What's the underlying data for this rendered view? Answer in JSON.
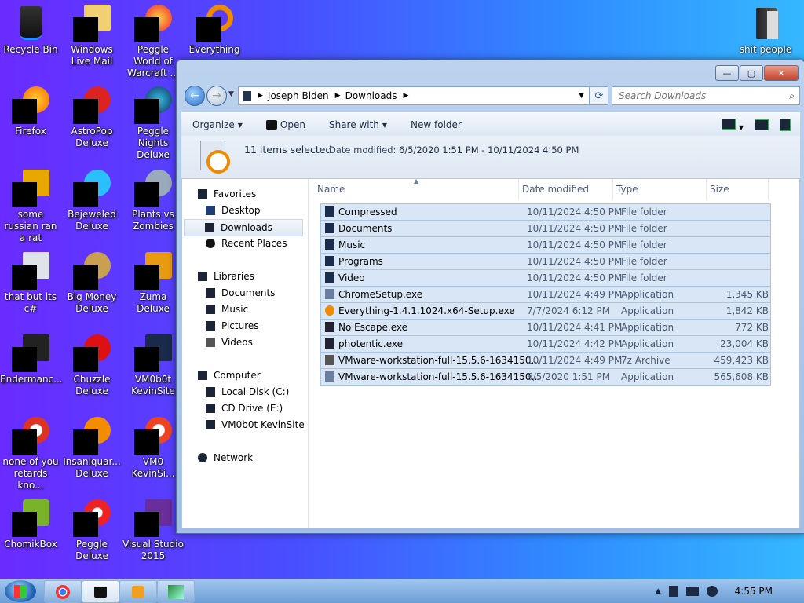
{
  "desktop": {
    "icons": [
      {
        "label": "Recycle Bin",
        "icon": "recycle-bin-icon"
      },
      {
        "label": "Windows Live Mail",
        "icon": "mail-icon"
      },
      {
        "label": "Peggle World of Warcraft ...",
        "icon": "game-icon"
      },
      {
        "label": "Everything",
        "icon": "search-app-icon"
      },
      {
        "label": "Firefox",
        "icon": "firefox-icon"
      },
      {
        "label": "AstroPop Deluxe",
        "icon": "game-icon"
      },
      {
        "label": "Peggle Nights Deluxe",
        "icon": "game-icon"
      },
      {
        "label": "some russian ran a rat",
        "icon": "file-icon"
      },
      {
        "label": "Bejeweled Deluxe",
        "icon": "game-icon"
      },
      {
        "label": "Plants vs Zombies",
        "icon": "game-icon"
      },
      {
        "label": "that but its c#",
        "icon": "file-icon"
      },
      {
        "label": "Big Money Deluxe",
        "icon": "game-icon"
      },
      {
        "label": "Zuma Deluxe",
        "icon": "game-icon"
      },
      {
        "label": "Endermanc...",
        "icon": "file-icon"
      },
      {
        "label": "Chuzzle Deluxe",
        "icon": "game-icon"
      },
      {
        "label": "VM0b0t KevinSite",
        "icon": "app-icon"
      },
      {
        "label": "none of you retards kno...",
        "icon": "chrome-icon"
      },
      {
        "label": "Insaniquar... Deluxe",
        "icon": "game-icon"
      },
      {
        "label": "VM0 KevinSi...",
        "icon": "chrome-icon"
      },
      {
        "label": "ChomikBox",
        "icon": "app-icon"
      },
      {
        "label": "Peggle Deluxe",
        "icon": "game-icon"
      },
      {
        "label": "Visual Studio 2015",
        "icon": "visual-studio-icon"
      },
      {
        "label": "shit people",
        "icon": "folder-icon"
      }
    ]
  },
  "window": {
    "caption": {
      "minimize": "—",
      "maximize": "▢",
      "close": "✕"
    },
    "address": {
      "segments": [
        "Joseph Biden",
        "Downloads"
      ]
    },
    "search": {
      "placeholder": "Search Downloads"
    },
    "toolbar": {
      "organize": "Organize",
      "open": "Open",
      "share_with": "Share with",
      "new_folder": "New folder"
    },
    "details": {
      "selected": "11 items selected",
      "date_label": "Date modified:",
      "date_range": "6/5/2020 1:51 PM - 10/11/2024 4:50 PM"
    },
    "nav": {
      "favorites": "Favorites",
      "desktop": "Desktop",
      "downloads": "Downloads",
      "recent": "Recent Places",
      "libraries": "Libraries",
      "documents": "Documents",
      "music": "Music",
      "pictures": "Pictures",
      "videos": "Videos",
      "computer": "Computer",
      "local_disk": "Local Disk (C:)",
      "cd_drive": "CD Drive (E:)",
      "vm_drive": "VM0b0t KevinSite",
      "network": "Network"
    },
    "columns": {
      "name": "Name",
      "date": "Date modified",
      "type": "Type",
      "size": "Size"
    },
    "files": [
      {
        "name": "Compressed",
        "date": "10/11/2024 4:50 PM",
        "type": "File folder",
        "size": "",
        "icon": "folder-icon"
      },
      {
        "name": "Documents",
        "date": "10/11/2024 4:50 PM",
        "type": "File folder",
        "size": "",
        "icon": "folder-icon"
      },
      {
        "name": "Music",
        "date": "10/11/2024 4:50 PM",
        "type": "File folder",
        "size": "",
        "icon": "folder-icon"
      },
      {
        "name": "Programs",
        "date": "10/11/2024 4:50 PM",
        "type": "File folder",
        "size": "",
        "icon": "folder-icon"
      },
      {
        "name": "Video",
        "date": "10/11/2024 4:50 PM",
        "type": "File folder",
        "size": "",
        "icon": "folder-icon"
      },
      {
        "name": "ChromeSetup.exe",
        "date": "10/11/2024 4:49 PM",
        "type": "Application",
        "size": "1,345 KB",
        "icon": "installer-icon"
      },
      {
        "name": "Everything-1.4.1.1024.x64-Setup.exe",
        "date": "7/7/2024 6:12 PM",
        "type": "Application",
        "size": "1,842 KB",
        "icon": "search-app-icon"
      },
      {
        "name": "No Escape.exe",
        "date": "10/11/2024 4:41 PM",
        "type": "Application",
        "size": "772 KB",
        "icon": "app-icon"
      },
      {
        "name": "photentic.exe",
        "date": "10/11/2024 4:42 PM",
        "type": "Application",
        "size": "23,004 KB",
        "icon": "app-icon"
      },
      {
        "name": "VMware-workstation-full-15.5.6-1634150...",
        "date": "10/11/2024 4:49 PM",
        "type": "7z Archive",
        "size": "459,423 KB",
        "icon": "archive-icon"
      },
      {
        "name": "VMware-workstation-full-15.5.6-1634150...",
        "date": "6/5/2020 1:51 PM",
        "type": "Application",
        "size": "565,608 KB",
        "icon": "installer-icon"
      }
    ]
  },
  "taskbar": {
    "clock": "4:55 PM"
  }
}
